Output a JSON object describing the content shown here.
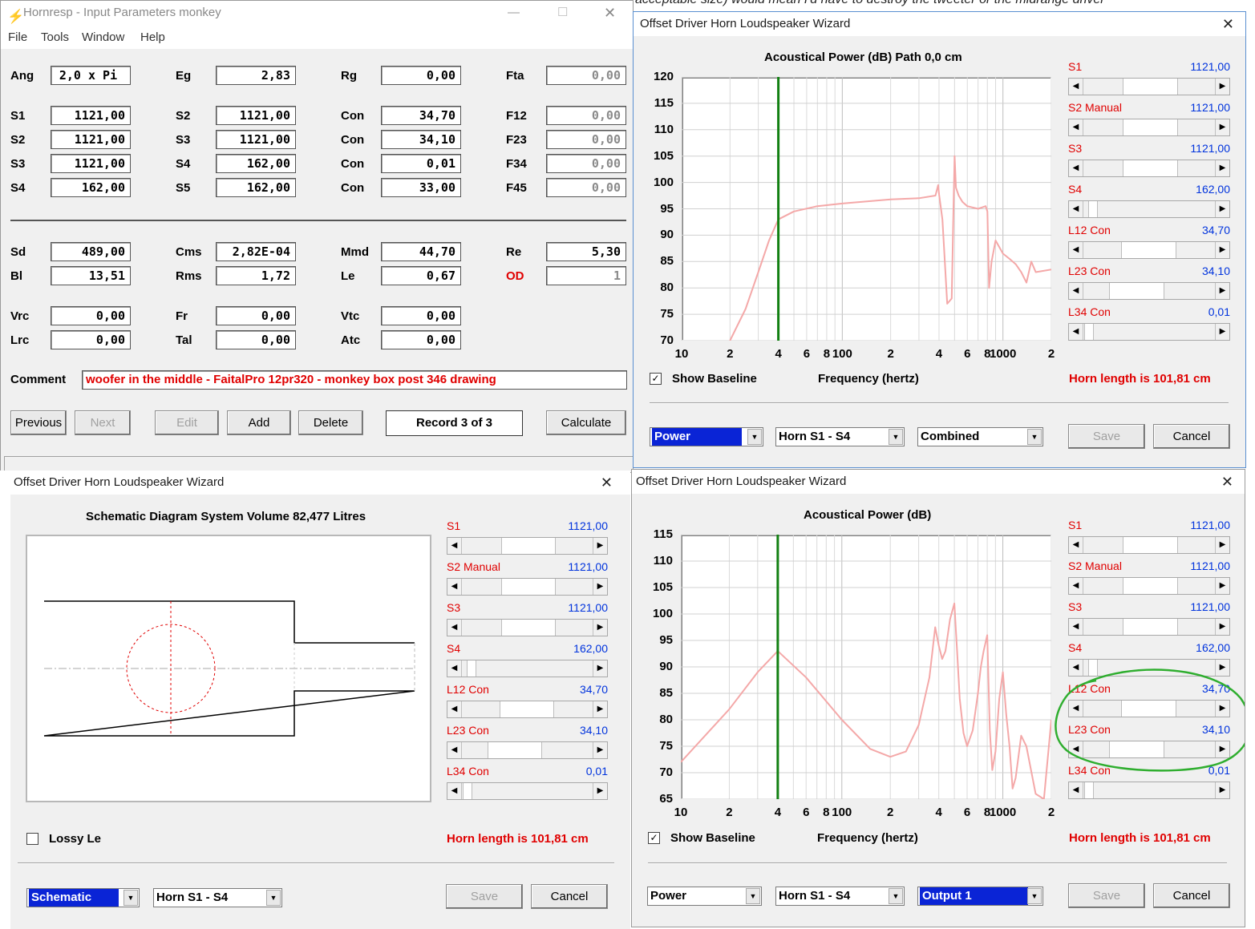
{
  "background_text": "acceptable size) would mean I'd have to destroy the tweeter or the midrange driver",
  "hornresp": {
    "title": "Hornresp - Input Parameters   monkey",
    "menu": [
      "File",
      "Tools",
      "Window",
      "Help"
    ],
    "params": [
      {
        "label": "Ang",
        "value": "2,0 x Pi"
      },
      {
        "label": "Eg",
        "value": "2,83"
      },
      {
        "label": "Rg",
        "value": "0,00"
      },
      {
        "label": "Fta",
        "value": "0,00"
      },
      {
        "label": "S1",
        "value": "1121,00"
      },
      {
        "label": "S2",
        "value": "1121,00"
      },
      {
        "label": "Con",
        "value": "34,70"
      },
      {
        "label": "F12",
        "value": "0,00"
      },
      {
        "label": "S2",
        "value": "1121,00"
      },
      {
        "label": "S3",
        "value": "1121,00"
      },
      {
        "label": "Con",
        "value": "34,10"
      },
      {
        "label": "F23",
        "value": "0,00"
      },
      {
        "label": "S3",
        "value": "1121,00"
      },
      {
        "label": "S4",
        "value": "162,00"
      },
      {
        "label": "Con",
        "value": "0,01"
      },
      {
        "label": "F34",
        "value": "0,00"
      },
      {
        "label": "S4",
        "value": "162,00"
      },
      {
        "label": "S5",
        "value": "162,00"
      },
      {
        "label": "Con",
        "value": "33,00"
      },
      {
        "label": "F45",
        "value": "0,00"
      },
      {
        "label": "Sd",
        "value": "489,00"
      },
      {
        "label": "Cms",
        "value": "2,82E-04"
      },
      {
        "label": "Mmd",
        "value": "44,70"
      },
      {
        "label": "Re",
        "value": "5,30"
      },
      {
        "label": "Bl",
        "value": "13,51"
      },
      {
        "label": "Rms",
        "value": "1,72"
      },
      {
        "label": "Le",
        "value": "0,67"
      },
      {
        "label": "OD",
        "value": "1"
      },
      {
        "label": "Vrc",
        "value": "0,00"
      },
      {
        "label": "Fr",
        "value": "0,00"
      },
      {
        "label": "Vtc",
        "value": "0,00"
      },
      {
        "label": "Lrc",
        "value": "0,00"
      },
      {
        "label": "Tal",
        "value": "0,00"
      },
      {
        "label": "Atc",
        "value": "0,00"
      }
    ],
    "comment_label": "Comment",
    "comment": "woofer in the middle - FaitalPro 12pr320 - monkey box post 346 drawing",
    "buttons": {
      "previous": "Previous",
      "next": "Next",
      "edit": "Edit",
      "add": "Add",
      "delete": "Delete",
      "calculate": "Calculate"
    },
    "record": "Record 3 of 3"
  },
  "wizard_title": "Offset Driver Horn Loudspeaker Wizard",
  "sliders": [
    {
      "label": "S1",
      "value": "1121,00",
      "thumb": 0.5
    },
    {
      "label": "S2  Manual",
      "value": "1121,00",
      "thumb": 0.5
    },
    {
      "label": "S3",
      "value": "1121,00",
      "thumb": 0.5
    },
    {
      "label": "S4",
      "value": "162,00",
      "thumb": 0.03
    },
    {
      "label": "L12  Con",
      "value": "34,70",
      "thumb": 0.48
    },
    {
      "label": "L23  Con",
      "value": "34,10",
      "thumb": 0.33
    },
    {
      "label": "L34  Con",
      "value": "0,01",
      "thumb": 0.0
    }
  ],
  "horn_length": "Horn length is 101,81 cm",
  "show_baseline": "Show Baseline",
  "save": "Save",
  "cancel": "Cancel",
  "freq_label": "Frequency (hertz)",
  "x_ticks": [
    "10",
    "2",
    "4",
    "6",
    "8",
    "100",
    "2",
    "4",
    "6",
    "8",
    "1000",
    "2"
  ],
  "top_right": {
    "title": "Acoustical Power (dB)    Path 0,0 cm",
    "combos": [
      "Power",
      "Horn S1 - S4",
      "Combined"
    ]
  },
  "bottom_left": {
    "title": "Schematic Diagram    System Volume 82,477 Litres",
    "lossy": "Lossy Le",
    "combos": [
      "Schematic",
      "Horn S1 - S4"
    ]
  },
  "bottom_right": {
    "title": "Acoustical Power (dB)",
    "combos": [
      "Power",
      "Horn S1 - S4",
      "Output 1"
    ]
  },
  "chart_data": [
    {
      "type": "line",
      "title": "Acoustical Power (dB)    Path 0,0 cm",
      "xlabel": "Frequency (hertz)",
      "x_scale": "log",
      "xlim": [
        10,
        2000
      ],
      "ylim": [
        70,
        120
      ],
      "y_ticks": [
        120,
        115,
        110,
        105,
        100,
        95,
        90,
        85,
        80,
        75,
        70
      ],
      "marker_x": 40,
      "grid": true,
      "series": [
        {
          "color": "#f4a8a8",
          "x": [
            20,
            25,
            30,
            35,
            40,
            50,
            70,
            100,
            200,
            300,
            380,
            395,
            400,
            420,
            450,
            480,
            490,
            500,
            510,
            530,
            560,
            600,
            700,
            780,
            800,
            820,
            850,
            900,
            1000,
            1100,
            1200,
            1300,
            1400,
            1500,
            1600,
            2000
          ],
          "y": [
            70,
            76,
            83,
            89,
            93,
            94.5,
            95.5,
            96,
            96.8,
            97,
            97.5,
            99.5,
            97.8,
            93,
            77,
            78,
            92,
            105,
            99,
            97.5,
            96.3,
            95.5,
            95,
            95.5,
            94.5,
            80,
            85,
            89,
            86.5,
            85.5,
            84.5,
            83,
            81,
            85,
            83,
            83.5
          ]
        }
      ]
    },
    {
      "type": "line",
      "title": "Acoustical Power (dB)",
      "xlabel": "Frequency (hertz)",
      "x_scale": "log",
      "xlim": [
        10,
        2000
      ],
      "ylim": [
        65,
        115
      ],
      "y_ticks": [
        115,
        110,
        105,
        100,
        95,
        90,
        85,
        80,
        75,
        70,
        65
      ],
      "marker_x": 40,
      "grid": true,
      "series": [
        {
          "color": "#f4a8a8",
          "x": [
            10,
            20,
            30,
            40,
            60,
            100,
            150,
            200,
            250,
            300,
            350,
            380,
            400,
            420,
            440,
            470,
            500,
            520,
            540,
            570,
            600,
            650,
            700,
            730,
            760,
            800,
            830,
            860,
            900,
            950,
            1000,
            1050,
            1100,
            1150,
            1200,
            1250,
            1300,
            1400,
            1600,
            1800,
            2000
          ],
          "y": [
            72,
            82,
            89,
            93,
            88,
            80,
            74.5,
            73,
            74,
            79,
            88,
            97.5,
            94,
            91.5,
            93,
            99,
            102,
            93,
            84,
            77.5,
            75,
            78,
            85,
            90,
            93,
            96,
            78,
            70.5,
            74,
            84,
            89,
            81,
            75,
            67,
            69,
            73,
            77,
            75,
            66,
            65,
            80
          ]
        }
      ]
    }
  ]
}
